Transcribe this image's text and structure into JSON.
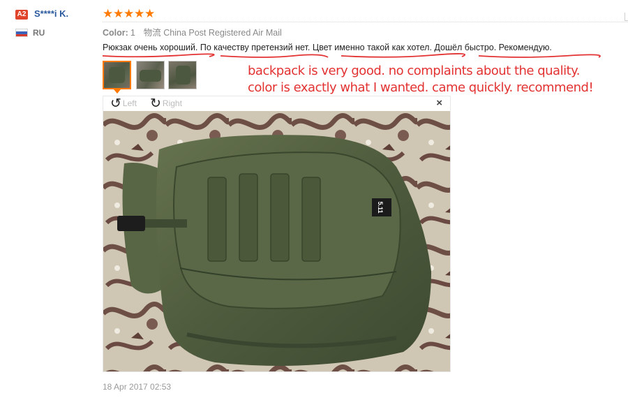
{
  "user": {
    "level_badge": "A2",
    "name": "S****i K.",
    "country": "RU"
  },
  "review": {
    "rating_stars": 5,
    "color_label": "Color:",
    "color_value": "1",
    "shipping": "物流 China Post Registered Air Mail",
    "text": "Рюкзак очень хороший. По качеству претензий нет. Цвет именно такой как хотел. Дошёл быстро. Рекомендую.",
    "annotation_line1": "backpack is very good. no complaints about the quality.",
    "annotation_line2": "color is exactly what I wanted. came quickly. recommend!",
    "date": "18 Apr 2017 02:53"
  },
  "viewer": {
    "rotate_left_label": "Left",
    "rotate_right_label": "Right",
    "close_glyph": "×",
    "patch_text": "5.11"
  },
  "colors": {
    "star": "#ff7a00",
    "accent_orange": "#ff7a00",
    "annotation_red": "#e33232",
    "username_blue": "#2a5a9e",
    "badge_red": "#e0452b"
  }
}
